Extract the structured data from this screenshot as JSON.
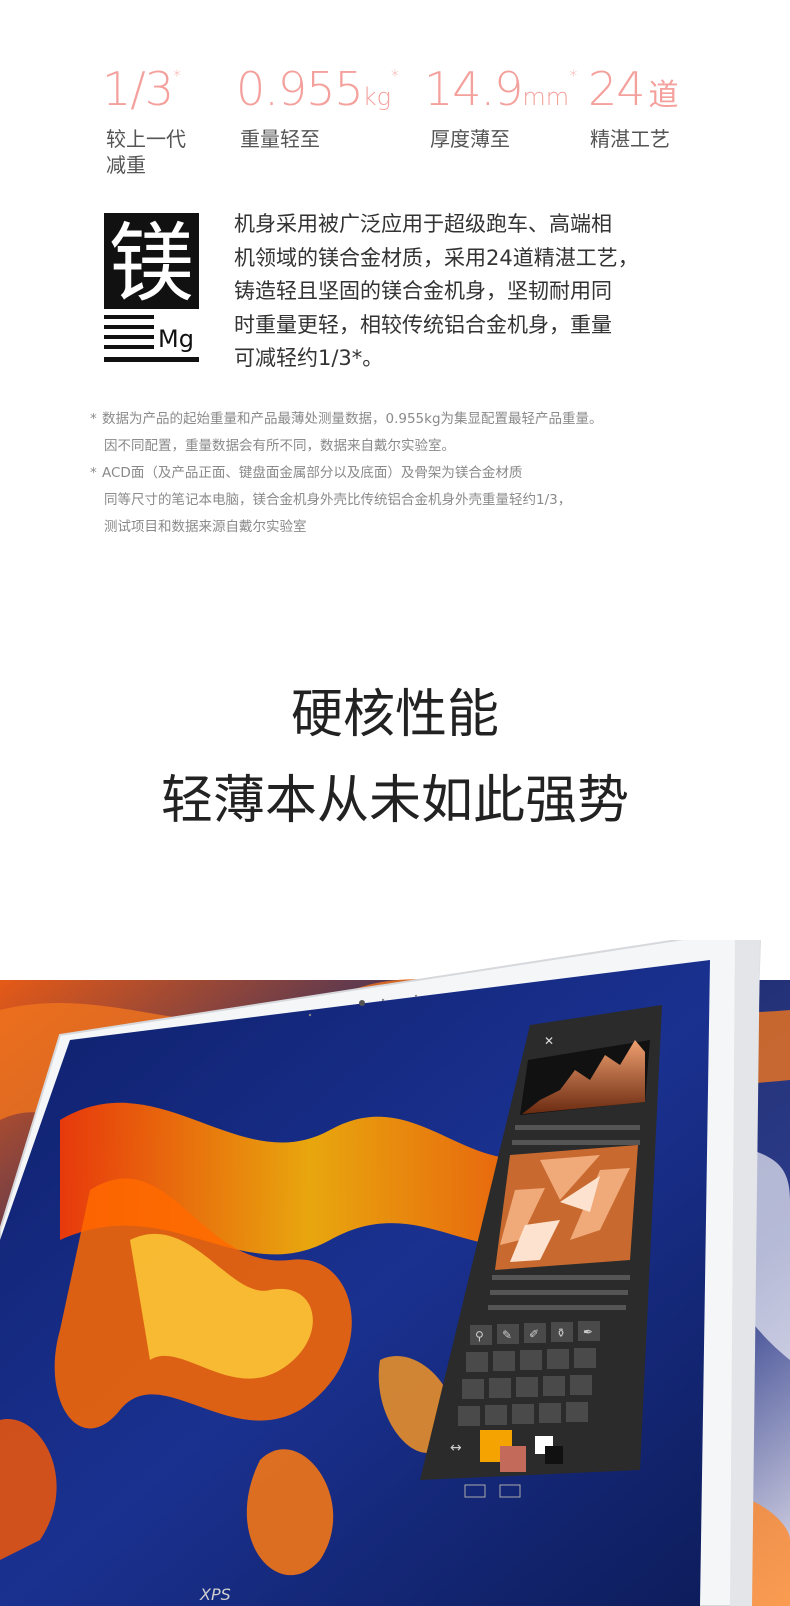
{
  "stats": [
    {
      "value": "1/3",
      "unit": "",
      "mark": "*",
      "label": "较上一代",
      "label2": "减重"
    },
    {
      "value": "0.955",
      "unit": "kg",
      "mark": "*",
      "label": "重量轻至",
      "label2": ""
    },
    {
      "value": "14.9",
      "unit": "mm",
      "mark": "*",
      "label": "厚度薄至",
      "label2": ""
    },
    {
      "value": "24",
      "unit": "道",
      "mark": "",
      "label": "精湛工艺",
      "label2": ""
    }
  ],
  "magnesium": {
    "glyph": "镁",
    "symbol": "Mg",
    "lines": [
      "机身采用被广泛应用于超级跑车、高端相",
      "机领域的镁合金材质，采用24道精湛工艺，",
      "铸造轻且坚固的镁合金机身，坚韧耐用同",
      "时重量更轻，相较传统铝合金机身，重量",
      "可减轻约1/3*。"
    ]
  },
  "footnotes": [
    {
      "star": "*",
      "text": "数据为产品的起始重量和产品最薄处测量数据，0.955kg为集显配置最轻产品重量。"
    },
    {
      "star": "",
      "text": "因不同配置，重量数据会有所不同，数据来自戴尔实验室。"
    },
    {
      "star": "*",
      "text": "ACD面（及产品正面、键盘面金属部分以及底面）及骨架为镁合金材质"
    },
    {
      "star": "",
      "text": "同等尺寸的笔记本电脑，镁合金机身外壳比传统铝合金机身外壳重量轻约1/3，"
    },
    {
      "star": "",
      "text": "测试项目和数据来源自戴尔实验室"
    }
  ],
  "headline": {
    "line1": "硬核性能",
    "line2": "轻薄本从未如此强势"
  },
  "colors": {
    "accent": "#f4a09c",
    "screen_blue": "#1a2d7a",
    "screen_orange": "#f06a1a",
    "swatch_orange": "#f5a300"
  },
  "icons": [
    "close-icon",
    "zoom-icon",
    "brush-icon",
    "pen-icon",
    "bucket-icon",
    "eyedropper-icon",
    "swap-arrow-icon"
  ]
}
